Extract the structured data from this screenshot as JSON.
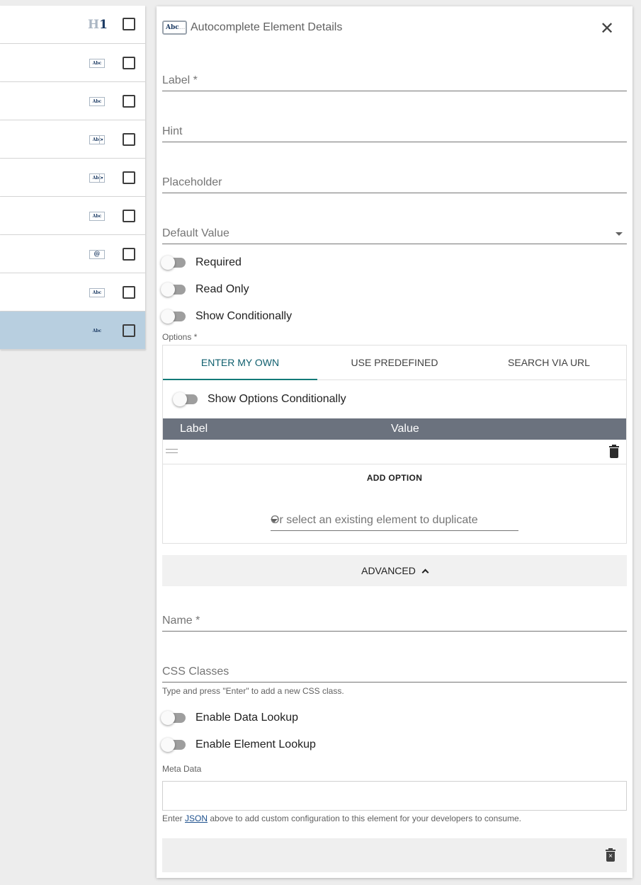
{
  "left_list": {
    "rows": [
      {
        "icon": "heading-icon",
        "glyph_a": "H",
        "glyph_b": "1"
      },
      {
        "icon": "text-field-icon",
        "glyph": "Abc"
      },
      {
        "icon": "text-field-icon",
        "glyph": "Abc"
      },
      {
        "icon": "dropdown-field-icon",
        "glyph": "Abc"
      },
      {
        "icon": "dropdown-field-icon",
        "glyph": "Abc"
      },
      {
        "icon": "text-field-icon",
        "glyph": "Abc"
      },
      {
        "icon": "email-field-icon",
        "glyph": "@"
      },
      {
        "icon": "text-field-icon",
        "glyph": "Abc"
      },
      {
        "icon": "autocomplete-field-icon",
        "glyph": "Abc",
        "selected": true
      }
    ]
  },
  "panel": {
    "icon_text": "Abc",
    "icon_dots": "...",
    "title": "Autocomplete Element Details",
    "close_glyph": "✕",
    "fields": {
      "label": "Label *",
      "hint": "Hint",
      "placeholder": "Placeholder",
      "default_value": "Default Value"
    },
    "toggles": {
      "required": "Required",
      "read_only": "Read Only",
      "show_conditionally": "Show Conditionally"
    },
    "options_label": "Options *",
    "tabs": [
      "ENTER MY OWN",
      "USE PREDEFINED",
      "SEARCH VIA URL"
    ],
    "show_options_conditionally": "Show Options Conditionally",
    "table": {
      "col_label": "Label",
      "col_value": "Value"
    },
    "add_option": "ADD OPTION",
    "duplicate_select": "Or select an existing element to duplicate",
    "advanced": "ADVANCED",
    "name_field": "Name *",
    "css_field": "CSS Classes",
    "css_hint": "Type and press \"Enter\" to add a new CSS class.",
    "enable_data_lookup": "Enable Data Lookup",
    "enable_element_lookup": "Enable Element Lookup",
    "meta_data_label": "Meta Data",
    "meta_hint_prefix": "Enter ",
    "meta_hint_link": "JSON",
    "meta_hint_suffix": " above to add custom configuration to this element for your developers to consume."
  },
  "colors": {
    "selected_row": "#b8cfe0",
    "active_tab_underline": "#137a78",
    "table_header": "#6b727e",
    "link": "#1c4f8c"
  }
}
